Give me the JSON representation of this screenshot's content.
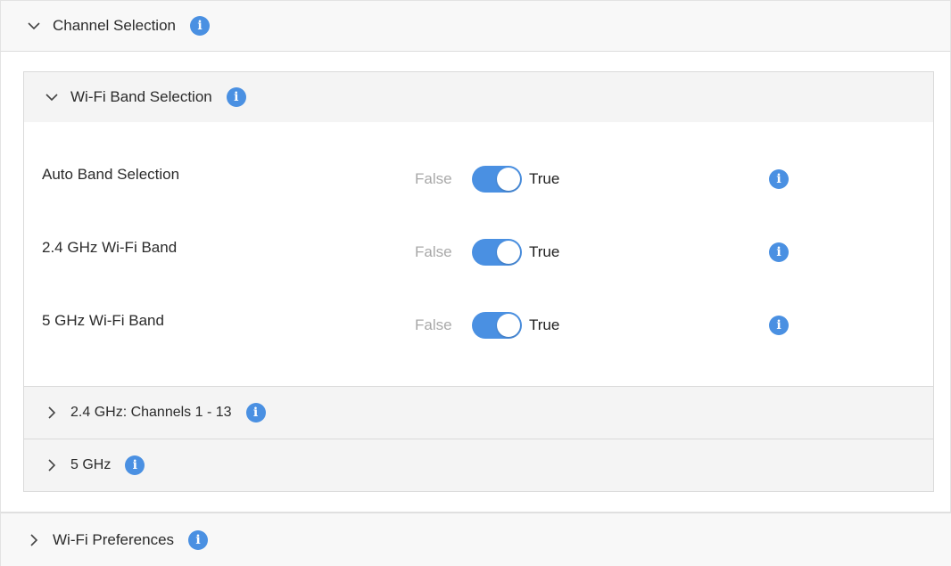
{
  "colors": {
    "accent": "#4a90e2",
    "header_bg": "#f8f8f8",
    "inner_bg": "#f4f4f4",
    "muted_text": "#a8a8a8"
  },
  "channel_selection": {
    "title": "Channel Selection",
    "expanded": true,
    "wifi_band_selection": {
      "title": "Wi-Fi Band Selection",
      "expanded": true,
      "rows": [
        {
          "label": "Auto Band Selection",
          "false_label": "False",
          "true_label": "True",
          "value": true
        },
        {
          "label": "2.4 GHz Wi-Fi Band",
          "false_label": "False",
          "true_label": "True",
          "value": true
        },
        {
          "label": "5 GHz Wi-Fi Band",
          "false_label": "False",
          "true_label": "True",
          "value": true
        }
      ]
    },
    "channels_24": {
      "title": "2.4 GHz: Channels 1 - 13",
      "expanded": false
    },
    "channels_5": {
      "title": "5 GHz",
      "expanded": false
    }
  },
  "wifi_preferences": {
    "title": "Wi-Fi Preferences",
    "expanded": false
  },
  "icons": {
    "info": "i",
    "expanded": "chevron-down-icon",
    "collapsed": "chevron-right-icon"
  }
}
